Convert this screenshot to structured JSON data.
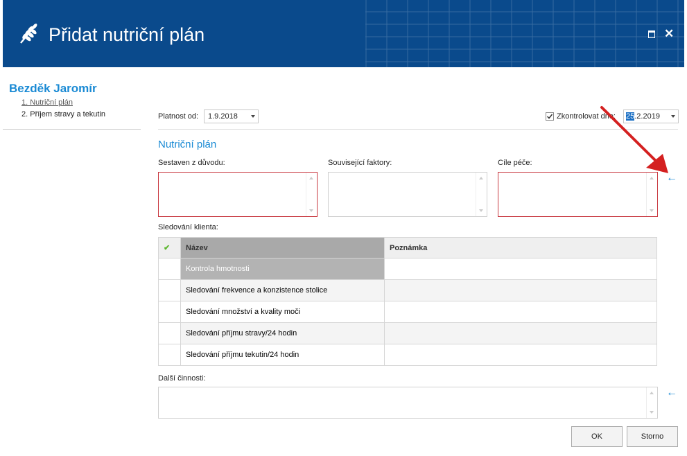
{
  "window": {
    "title": "Přidat nutriční plán",
    "icon": "wheat-icon"
  },
  "colors": {
    "titlebar": "#0a4a8c",
    "accent": "#1a8ad4",
    "error_border": "#c8373f",
    "annotation_arrow": "#d42020",
    "check": "#5cb82e"
  },
  "nav": {
    "client_name": "Bezděk Jaromír",
    "items": [
      "1. Nutriční plán",
      "2. Příjem stravy a tekutin"
    ]
  },
  "form": {
    "platnost_label": "Platnost od:",
    "platnost_value": "1.9.2018",
    "zkontrolovat_label": "Zkontrolovat dne:",
    "zkontrolovat_checked": true,
    "zkontrolovat_day": "25",
    "zkontrolovat_rest": ".2.2019",
    "section_title": "Nutriční plán",
    "sestaven_label": "Sestaven z důvodu:",
    "souvisejici_label": "Související faktory:",
    "cile_label": "Cíle péče:",
    "sledovani_label": "Sledování klienta:",
    "dalsi_label": "Další činnosti:"
  },
  "table": {
    "headers": {
      "check": "✔",
      "name": "Název",
      "note": "Poznámka"
    },
    "rows": [
      {
        "name": "Kontrola hmotnosti",
        "note": ""
      },
      {
        "name": "Sledování frekvence a konzistence stolice",
        "note": ""
      },
      {
        "name": "Sledování množství a kvality moči",
        "note": ""
      },
      {
        "name": "Sledování příjmu stravy/24 hodin",
        "note": ""
      },
      {
        "name": "Sledování příjmu tekutin/24 hodin",
        "note": ""
      }
    ]
  },
  "buttons": {
    "ok": "OK",
    "cancel": "Storno"
  },
  "icons": {
    "back_arrow": "←",
    "close": "✕"
  }
}
